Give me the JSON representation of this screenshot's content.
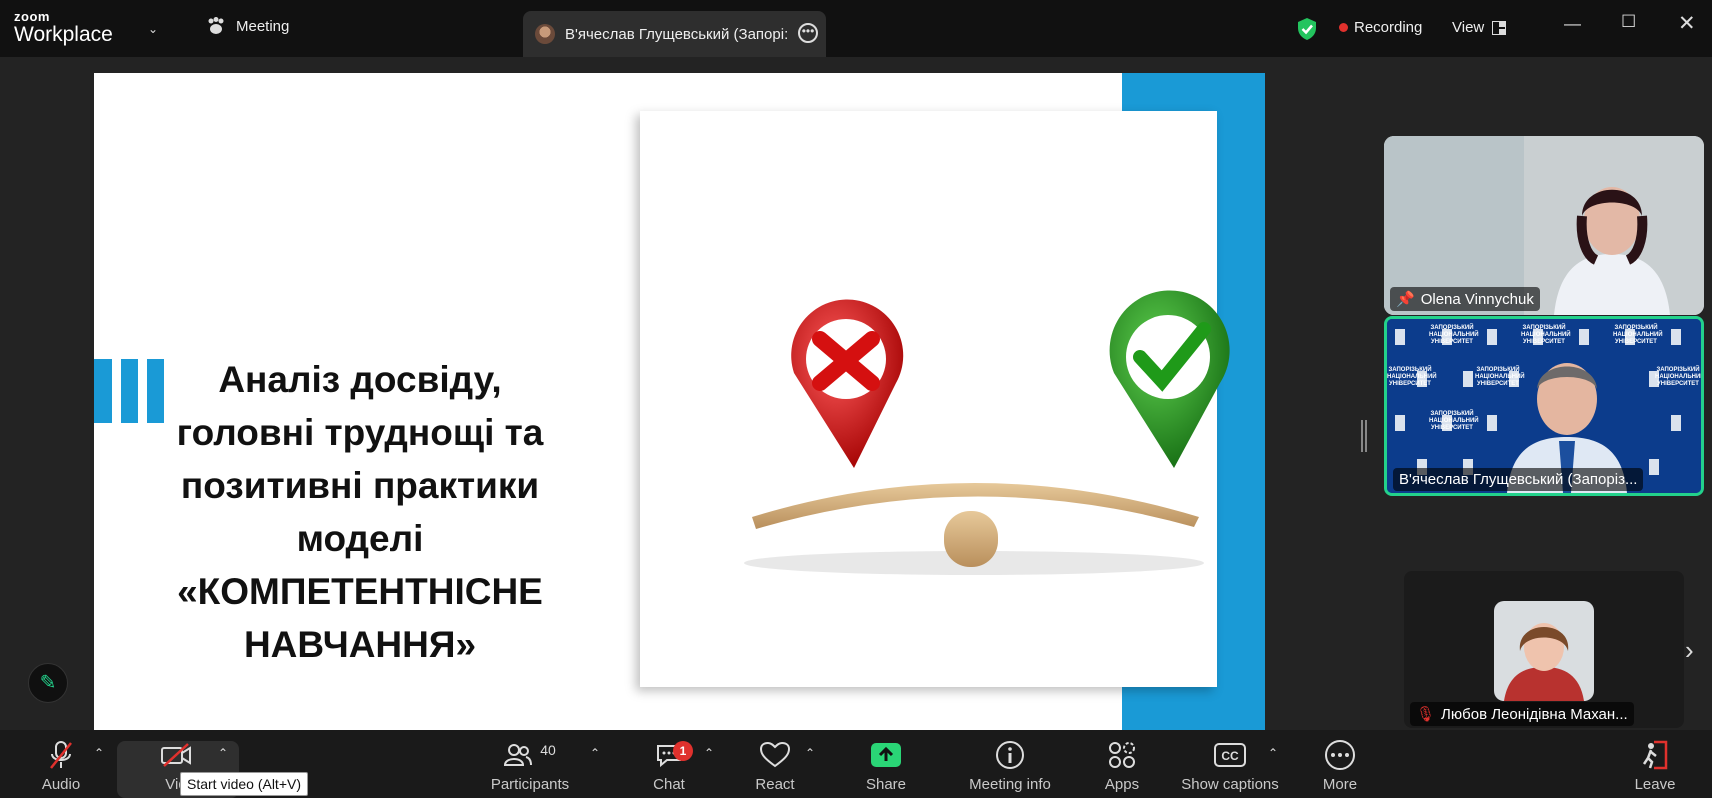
{
  "titlebar": {
    "logo_top": "zoom",
    "logo_bottom": "Workplace",
    "meeting_label": "Meeting",
    "speaker_tab": "В'ячеслав Глущевський (Запорі:",
    "recording_label": "Recording",
    "view_label": "View"
  },
  "slide": {
    "title": "Аналіз досвіду, головні труднощі та позитивні практики моделі «КОМПЕТЕНТНІСНЕ НАВЧАННЯ»"
  },
  "participants_panel": {
    "tiles": [
      {
        "name": "Olena Vinnychuk"
      },
      {
        "name": "В'ячеслав Глущевський (Запоріз..."
      },
      {
        "name": "Любов Леонідівна Махан..."
      }
    ],
    "wall_text": "ЗАПОРІЗЬКИЙ НАЦІОНАЛЬНИЙ УНІВЕРСИТЕТ"
  },
  "toolbar": {
    "audio": "Audio",
    "video": "Vid",
    "video_tooltip": "Start video (Alt+V)",
    "participants": "Participants",
    "participants_count": "40",
    "chat": "Chat",
    "chat_badge": "1",
    "react": "React",
    "share": "Share",
    "meeting_info": "Meeting info",
    "apps": "Apps",
    "show_captions": "Show captions",
    "more": "More",
    "leave": "Leave"
  },
  "colors": {
    "accent_green": "#23d18b",
    "slide_blue": "#1a9ad6",
    "record_red": "#e0312d"
  }
}
